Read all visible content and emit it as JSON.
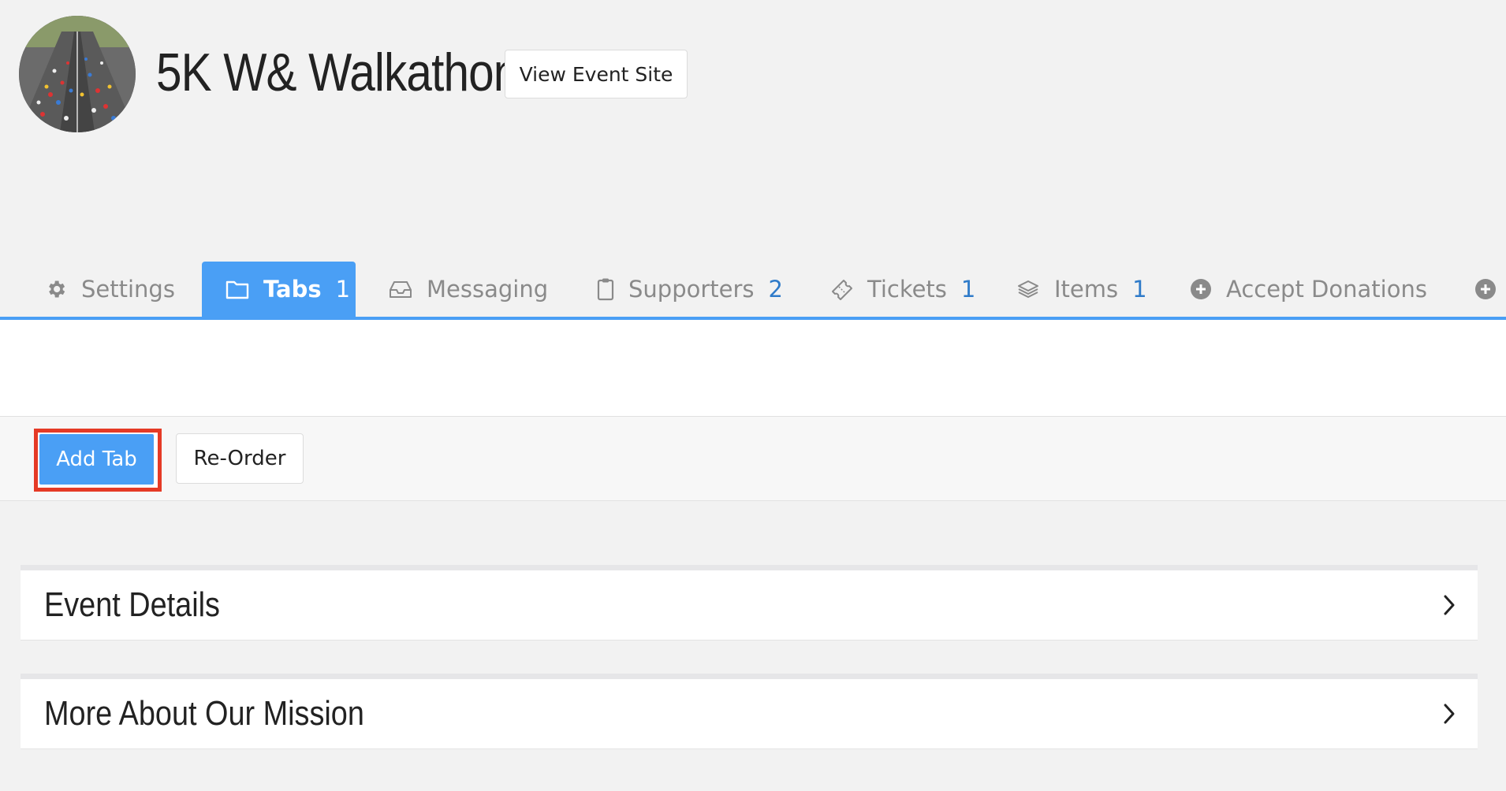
{
  "header": {
    "title": "5K W& Walkathon",
    "view_site_label": "View Event Site"
  },
  "tabs": [
    {
      "label": "Settings",
      "icon": "gear-icon",
      "count": ""
    },
    {
      "label": "Tabs",
      "icon": "folder-icon",
      "count": "1",
      "active": true
    },
    {
      "label": "Messaging",
      "icon": "inbox-icon",
      "count": ""
    },
    {
      "label": "Supporters",
      "icon": "clipboard-icon",
      "count": "2"
    },
    {
      "label": "Tickets",
      "icon": "ticket-icon",
      "count": "1"
    },
    {
      "label": "Items",
      "icon": "layers-icon",
      "count": "1"
    },
    {
      "label": "Accept Donations",
      "icon": "plus-circle-icon",
      "count": ""
    },
    {
      "label": "",
      "icon": "plus-circle-icon",
      "count": ""
    }
  ],
  "toolbar": {
    "add_tab_label": "Add Tab",
    "reorder_label": "Re-Order"
  },
  "panels": [
    {
      "title": "Event Details"
    },
    {
      "title": "More About Our Mission"
    }
  ],
  "colors": {
    "accent": "#4a9ff5",
    "count": "#2f7bc9",
    "highlight": "#e53a26"
  }
}
